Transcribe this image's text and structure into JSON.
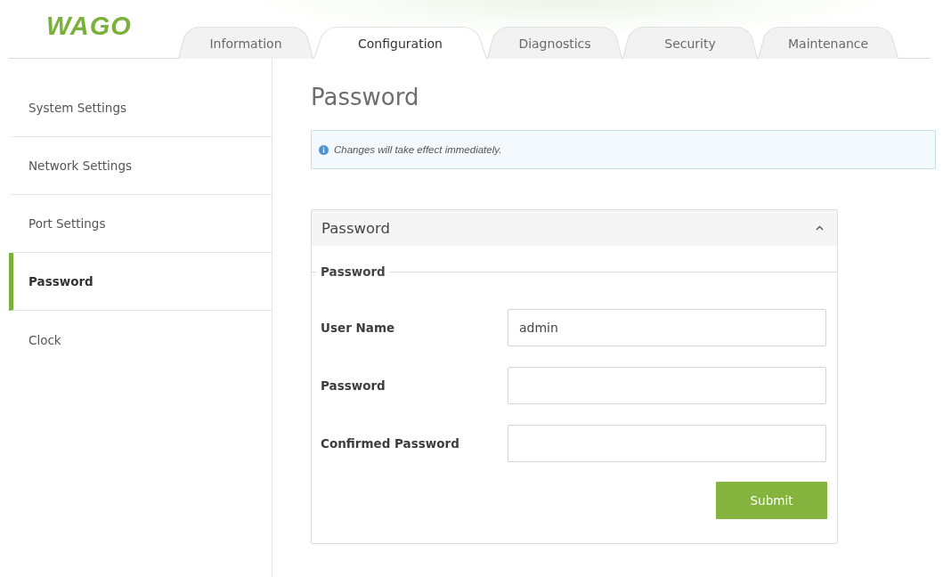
{
  "header": {
    "logo": "WAGO"
  },
  "tabs": [
    {
      "label": "Information",
      "selected": false
    },
    {
      "label": "Configuration",
      "selected": true
    },
    {
      "label": "Diagnostics",
      "selected": false
    },
    {
      "label": "Security",
      "selected": false
    },
    {
      "label": "Maintenance",
      "selected": false
    }
  ],
  "sidebar": {
    "items": [
      {
        "label": "System Settings",
        "selected": false
      },
      {
        "label": "Network Settings",
        "selected": false
      },
      {
        "label": "Port Settings",
        "selected": false
      },
      {
        "label": "Password",
        "selected": true
      },
      {
        "label": "Clock",
        "selected": false
      }
    ]
  },
  "page_title": "Password",
  "notice": {
    "text": "Changes will take effect immediately."
  },
  "panel": {
    "title": "Password",
    "expanded": true,
    "fieldset": {
      "legend": "Password",
      "fields": [
        {
          "label": "User Name",
          "value": "admin"
        },
        {
          "label": "Password"
        },
        {
          "label": "Confirmed Password"
        }
      ]
    },
    "submit": "Submit"
  }
}
